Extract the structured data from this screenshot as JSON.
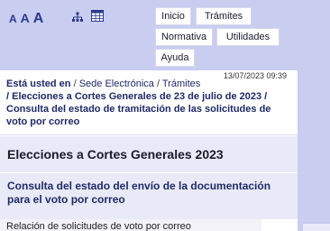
{
  "toolbar": {
    "font_small": "A",
    "font_medium": "A",
    "font_large": "A",
    "sitemap_icon": "sitemap-icon",
    "accessibility_icon": "grid-icon"
  },
  "menu": {
    "inicio": "Inicio",
    "tramites": "Trámites",
    "normativa": "Normativa",
    "utilidades": "Utilidades",
    "ayuda": "Ayuda"
  },
  "breadcrumb": {
    "timestamp": "13/07/2023 09:39",
    "label": "Está usted en",
    "item1": "Sede Electrónica",
    "item2": "Trámites",
    "current": "Elecciones a Cortes Generales de 23 de julio de 2023",
    "current2": "Consulta del estado de tramitación de las solicitudes de voto por correo"
  },
  "page": {
    "title": "Elecciones a Cortes Generales 2023",
    "subtitle": "Consulta del estado del envío de la documentación para el voto por correo",
    "section_label": "Relación de solicitudes de voto por correo"
  },
  "colors": {
    "header_bg": "#c9cdf0",
    "panel_bg": "#e9eaf7",
    "accent": "#1f2a66"
  }
}
